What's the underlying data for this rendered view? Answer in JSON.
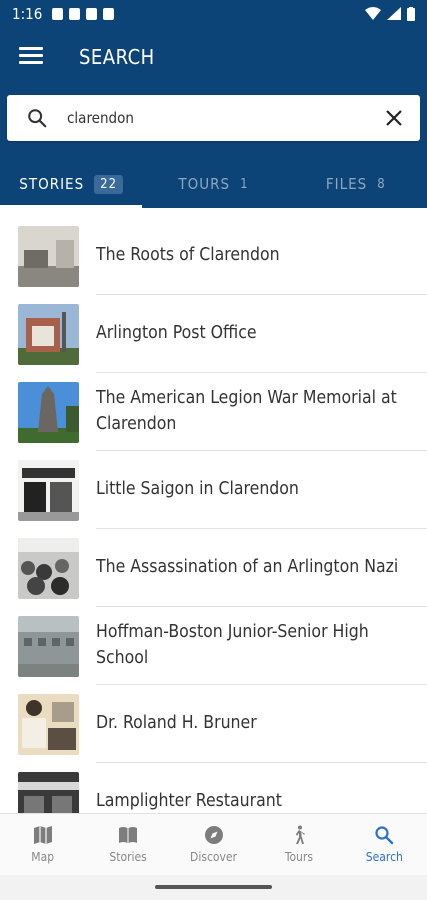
{
  "status": {
    "time": "1:16"
  },
  "header": {
    "title": "SEARCH"
  },
  "search": {
    "value": "clarendon",
    "placeholder": ""
  },
  "tabs": [
    {
      "label": "STORIES",
      "count": "22"
    },
    {
      "label": "TOURS",
      "count": "1"
    },
    {
      "label": "FILES",
      "count": "8"
    }
  ],
  "results": [
    {
      "title": "The Roots of Clarendon"
    },
    {
      "title": "Arlington Post Office"
    },
    {
      "title": "The American Legion War Memorial at Clarendon"
    },
    {
      "title": "Little Saigon in Clarendon"
    },
    {
      "title": "The Assassination of an Arlington Nazi"
    },
    {
      "title": "Hoffman-Boston Junior-Senior High School"
    },
    {
      "title": "Dr. Roland H. Bruner"
    },
    {
      "title": "Lamplighter Restaurant"
    }
  ],
  "nav": [
    {
      "label": "Map",
      "icon": "map-icon"
    },
    {
      "label": "Stories",
      "icon": "book-icon"
    },
    {
      "label": "Discover",
      "icon": "compass-icon"
    },
    {
      "label": "Tours",
      "icon": "walking-icon"
    },
    {
      "label": "Search",
      "icon": "search-icon"
    }
  ],
  "colors": {
    "header": "#0d4477",
    "accent": "#2f72c4"
  }
}
